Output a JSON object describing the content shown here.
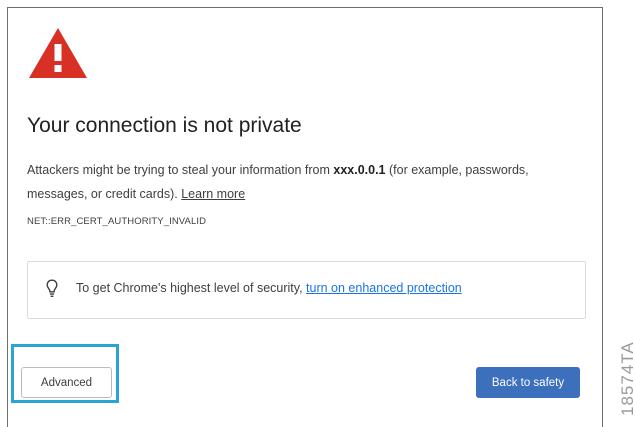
{
  "page": {
    "title": "Your connection is not private",
    "body_prefix": "Attackers might be trying to steal your information from ",
    "host": "xxx.0.0.1",
    "body_suffix": " (for example, passwords, messages, or credit cards). ",
    "learn_more": "Learn more",
    "error_code": "NET::ERR_CERT_AUTHORITY_INVALID"
  },
  "security_tip": {
    "icon": "lightbulb-icon",
    "text": "To get Chrome's highest level of security, ",
    "link": "turn on enhanced protection"
  },
  "buttons": {
    "advanced": "Advanced",
    "back_to_safety": "Back to safety"
  },
  "figure_id": "18574TA",
  "colors": {
    "warning_red": "#d93025",
    "primary_button": "#3c6fbc",
    "link_blue": "#1a73e8",
    "highlight_frame": "#2aa3d6"
  }
}
